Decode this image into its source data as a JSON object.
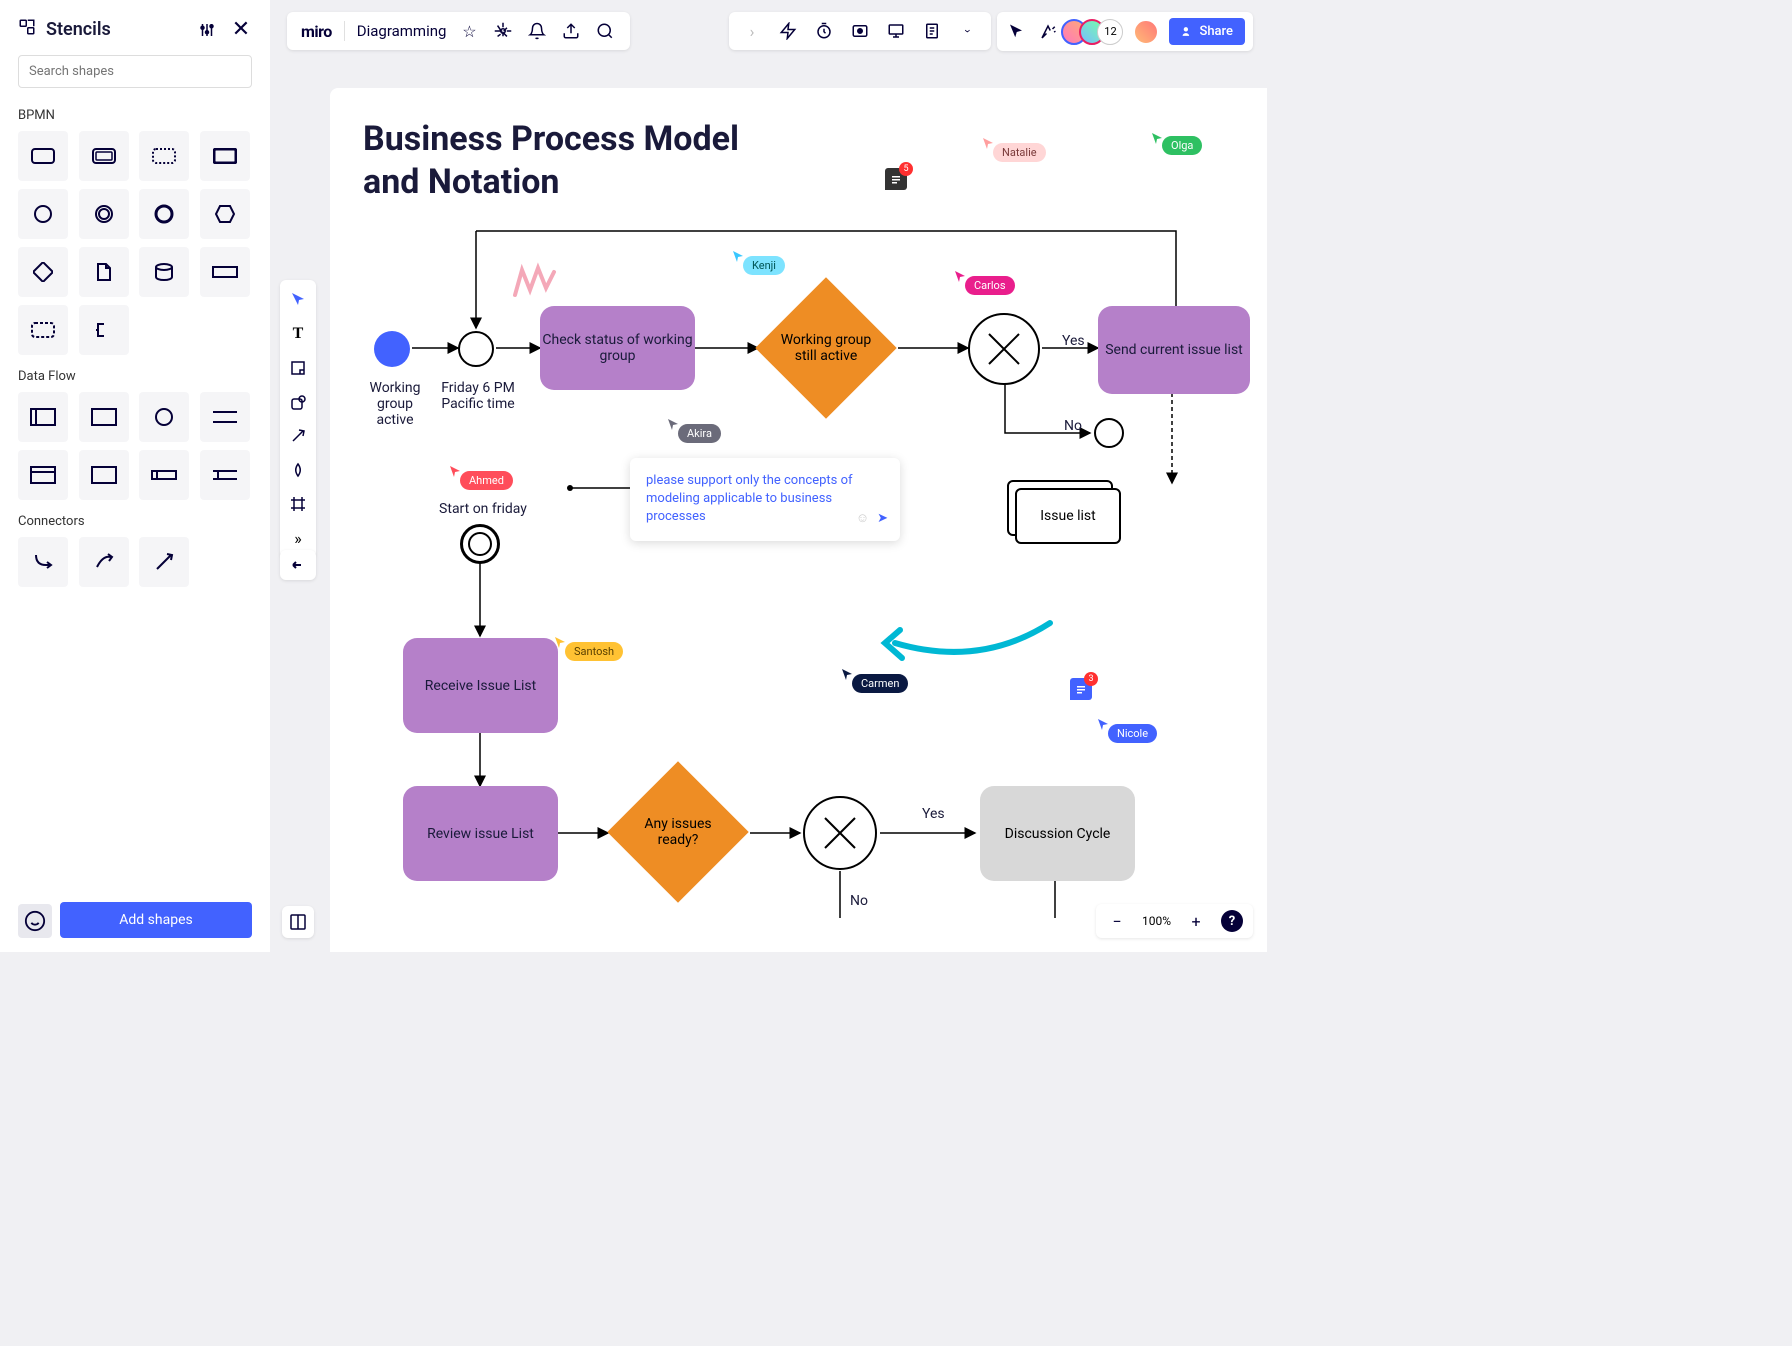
{
  "stencils": {
    "title": "Stencils",
    "search_placeholder": "Search shapes",
    "categories": {
      "bpmn": "BPMN",
      "dataflow": "Data Flow",
      "connectors": "Connectors"
    },
    "add_button": "Add shapes"
  },
  "board": {
    "logo": "miro",
    "name": "Diagramming"
  },
  "share": {
    "button": "Share",
    "avatar_count": "12"
  },
  "zoom": {
    "level": "100%"
  },
  "canvas": {
    "title_line1": "Business Process Model",
    "title_line2": "and Notation",
    "nodes": {
      "start_label": "Working group active",
      "timer_label": "Friday 6 PM Pacific time",
      "check_status": "Check status of working group",
      "group_active": "Working group still active",
      "send_list": "Send current issue list",
      "issue_list": "Issue list",
      "start_friday": "Start on friday",
      "receive": "Receive Issue List",
      "review": "Review issue List",
      "any_issues": "Any issues ready?",
      "discussion": "Discussion Cycle",
      "yes1": "Yes",
      "no1": "No",
      "yes2": "Yes",
      "no2": "No"
    },
    "cursors": {
      "natalie": "Natalie",
      "olga": "Olga",
      "kenji": "Kenji",
      "carlos": "Carlos",
      "akira": "Akira",
      "ahmed": "Ahmed",
      "santosh": "Santosh",
      "carmen": "Carmen",
      "nicole": "Nicole"
    },
    "comment_text": "please support only the concepts of modeling applicable to business processes",
    "comment_counts": {
      "dark": "5",
      "blue": "3"
    }
  }
}
